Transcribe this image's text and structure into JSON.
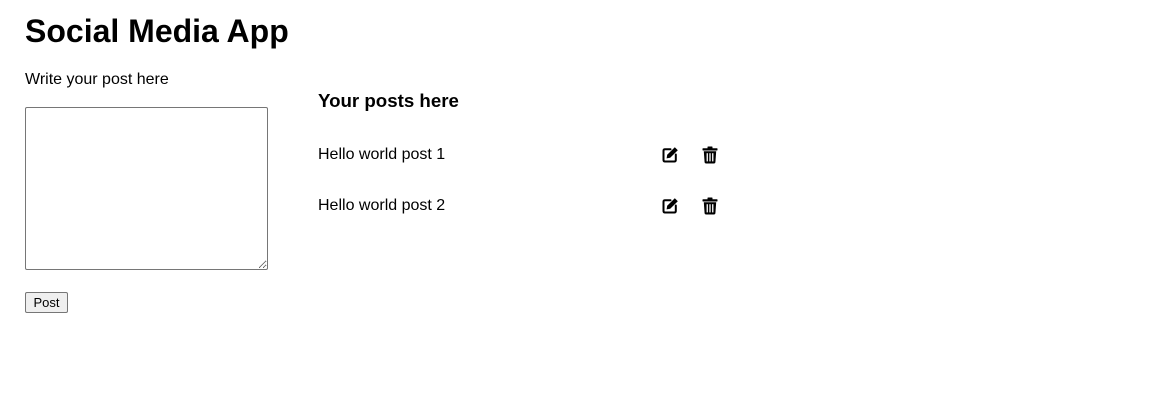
{
  "app": {
    "title": "Social Media App"
  },
  "composer": {
    "label": "Write your post here",
    "textarea_value": "",
    "post_button_label": "Post"
  },
  "posts": {
    "heading": "Your posts here",
    "items": [
      {
        "text": "Hello world post 1",
        "edit_icon": "edit-icon",
        "delete_icon": "trash-icon"
      },
      {
        "text": "Hello world post 2",
        "edit_icon": "edit-icon",
        "delete_icon": "trash-icon"
      }
    ]
  }
}
